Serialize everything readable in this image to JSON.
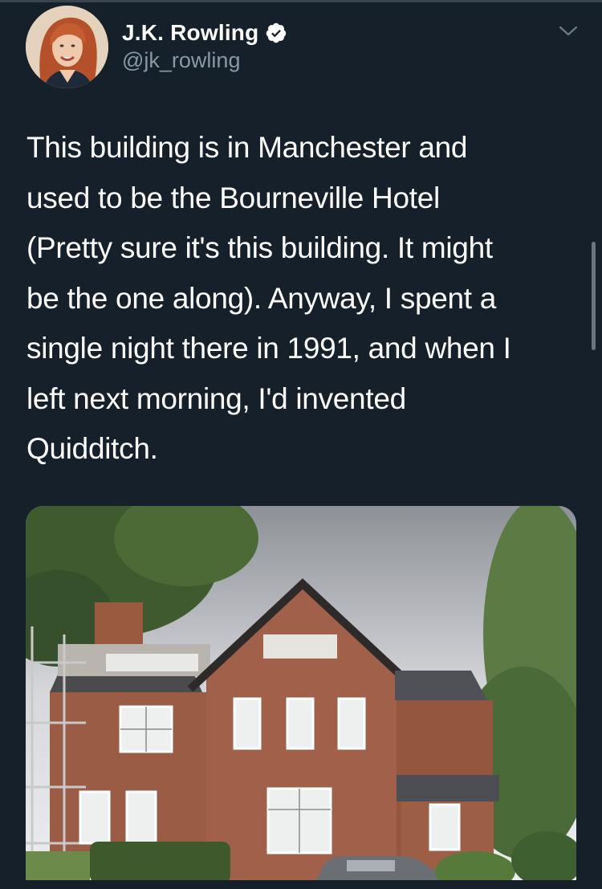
{
  "tweet": {
    "author": {
      "display_name": "J.K. Rowling",
      "handle": "@jk_rowling",
      "verified": true,
      "avatar_icon": "profile-photo"
    },
    "menu_icon": "chevron-down-icon",
    "text": "This building is in Manchester and\nused to be the Bourneville Hotel\n(Pretty sure it's this building. It might\nbe the one along). Anyway, I spent a\nsingle night there in 1991, and when I\nleft next morning, I'd invented\nQuidditch.",
    "media": {
      "type": "photo",
      "subject": "red-brick-building"
    }
  },
  "theme": {
    "background": "#15202b",
    "text_primary": "#ffffff",
    "text_secondary": "#8899a6",
    "verified_badge": "#ffffff"
  }
}
